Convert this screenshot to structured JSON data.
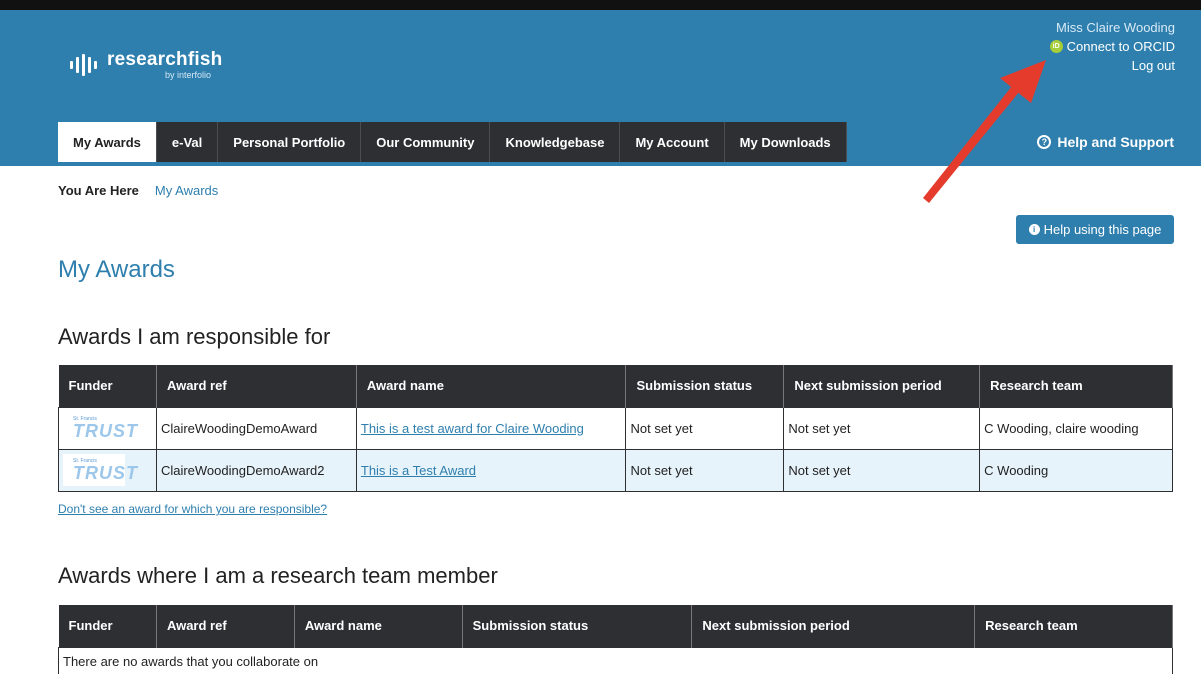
{
  "brand": {
    "name": "researchfish",
    "sub": "by interfolio"
  },
  "user": {
    "name": "Miss Claire Wooding",
    "orcid_label": "Connect to ORCID",
    "orcid_icon_text": "iD",
    "logout_label": "Log out"
  },
  "nav": {
    "tabs": [
      {
        "label": "My Awards"
      },
      {
        "label": "e-Val"
      },
      {
        "label": "Personal Portfolio"
      },
      {
        "label": "Our Community"
      },
      {
        "label": "Knowledgebase"
      },
      {
        "label": "My Account"
      },
      {
        "label": "My Downloads"
      }
    ],
    "active_tab": "My Awards",
    "help_support": "Help and Support"
  },
  "breadcrumb": {
    "here_label": "You Are Here",
    "current": "My Awards"
  },
  "help_page_button": "Help using this page",
  "page_title": "My Awards",
  "responsible": {
    "title": "Awards I am responsible for",
    "columns": [
      "Funder",
      "Award ref",
      "Award name",
      "Submission status",
      "Next submission period",
      "Research team"
    ],
    "rows": [
      {
        "funder_small": "St. Francis",
        "funder_big": "TRUST",
        "ref": "ClaireWoodingDemoAward",
        "name": "This is a test award for Claire Wooding",
        "status": "Not set yet",
        "next_period": "Not set yet",
        "team": "C Wooding, claire wooding"
      },
      {
        "funder_small": "St. Francis",
        "funder_big": "TRUST",
        "ref": "ClaireWoodingDemoAward2",
        "name": "This is a Test Award",
        "status": "Not set yet",
        "next_period": "Not set yet",
        "team": "C Wooding"
      }
    ],
    "missing_link": "Don't see an award for which you are responsible?"
  },
  "member": {
    "title": "Awards where I am a research team member",
    "columns": [
      "Funder",
      "Award ref",
      "Award name",
      "Submission status",
      "Next submission period",
      "Research team"
    ],
    "empty_message": "There are no awards that you collaborate on"
  },
  "colors": {
    "header": "#2e7fae",
    "nav": "#2d2f33",
    "arrow": "#e53b2c",
    "orcid": "#a6ce39"
  }
}
